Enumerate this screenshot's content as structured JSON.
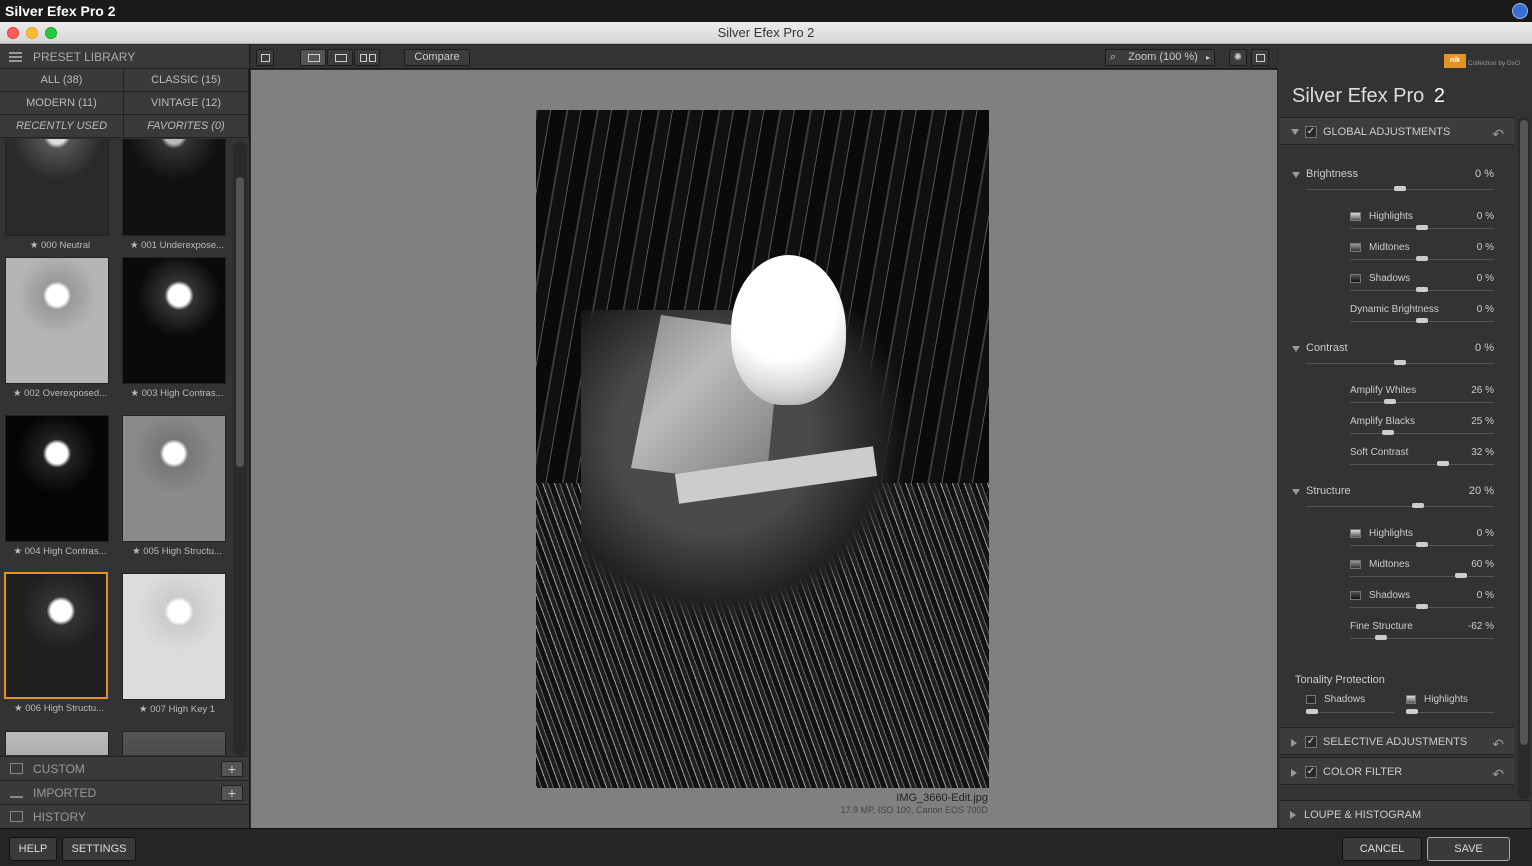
{
  "menubar": {
    "app_name": "Silver Efex Pro 2"
  },
  "window": {
    "title": "Silver Efex Pro 2"
  },
  "library": {
    "header": "PRESET LIBRARY",
    "categories": [
      {
        "label": "ALL (38)"
      },
      {
        "label": "CLASSIC (15)"
      },
      {
        "label": "MODERN (11)"
      },
      {
        "label": "VINTAGE (12)"
      },
      {
        "label": "RECENTLY USED"
      },
      {
        "label": "FAVORITES (0)"
      }
    ],
    "presets": [
      {
        "label": "★ 000 Neutral"
      },
      {
        "label": "★ 001 Underexpose..."
      },
      {
        "label": "★ 002 Overexposed..."
      },
      {
        "label": "★ 003 High Contras..."
      },
      {
        "label": "★ 004 High Contras..."
      },
      {
        "label": "★ 005 High Structu..."
      },
      {
        "label": "★ 006 High Structu..."
      },
      {
        "label": "★ 007 High Key 1"
      }
    ],
    "custom_label": "CUSTOM",
    "imported_label": "IMPORTED",
    "history_label": "HISTORY",
    "add_glyph": "+"
  },
  "toolbar": {
    "compare_label": "Compare",
    "zoom_label": "Zoom (100 %)"
  },
  "image": {
    "filename": "IMG_3660-Edit.jpg",
    "meta": "17.9 MP, ISO 100, Canon EOS 700D"
  },
  "panel": {
    "product_name": "Silver Efex Pro",
    "product_version": "2",
    "logo_text": "nik",
    "logo_caption": "Collection by DxO",
    "global_label": "GLOBAL ADJUSTMENTS",
    "check_glyph": "✓",
    "undo_glyph": "↶",
    "brightness": {
      "label": "Brightness",
      "value": "0 %",
      "highlights": {
        "label": "Highlights",
        "value": "0 %"
      },
      "midtones": {
        "label": "Midtones",
        "value": "0 %"
      },
      "shadows": {
        "label": "Shadows",
        "value": "0 %"
      },
      "dynamic": {
        "label": "Dynamic Brightness",
        "value": "0 %"
      }
    },
    "contrast": {
      "label": "Contrast",
      "value": "0 %",
      "amplify_whites": {
        "label": "Amplify Whites",
        "value": "26 %"
      },
      "amplify_blacks": {
        "label": "Amplify Blacks",
        "value": "25 %"
      },
      "soft": {
        "label": "Soft Contrast",
        "value": "32 %"
      }
    },
    "structure": {
      "label": "Structure",
      "value": "20 %",
      "highlights": {
        "label": "Highlights",
        "value": "0 %"
      },
      "midtones": {
        "label": "Midtones",
        "value": "60 %"
      },
      "shadows": {
        "label": "Shadows",
        "value": "0 %"
      },
      "fine": {
        "label": "Fine Structure",
        "value": "-62 %"
      }
    },
    "tonality": {
      "label": "Tonality Protection",
      "shadows_label": "Shadows",
      "highlights_label": "Highlights"
    },
    "selective_label": "SELECTIVE ADJUSTMENTS",
    "color_filter_label": "COLOR FILTER",
    "loupe_label": "LOUPE & HISTOGRAM"
  },
  "bottom": {
    "help_label": "HELP",
    "settings_label": "SETTINGS",
    "cancel_label": "CANCEL",
    "save_label": "SAVE"
  }
}
